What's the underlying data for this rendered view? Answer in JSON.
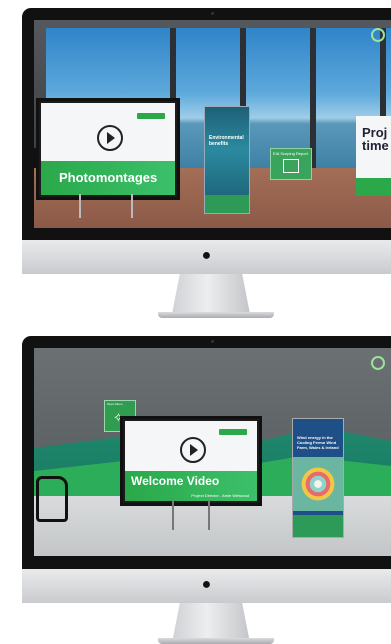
{
  "screen1": {
    "tv_title": "Photomontages",
    "banner_title": "Environmental benefits",
    "report_label": "EIA Scoping Report",
    "project_text": "Proj time"
  },
  "screen2": {
    "sign_label": "Open Menu",
    "tv_title": "Welcome Video",
    "tv_subtitle": "Project Director - Amie Wetwood",
    "banner_title": "Wind energy in the Cooling Fermo Wind Farm, Wales & Ireland"
  },
  "brand": {
    "green": "#2aa84a",
    "apple_logo": ""
  }
}
